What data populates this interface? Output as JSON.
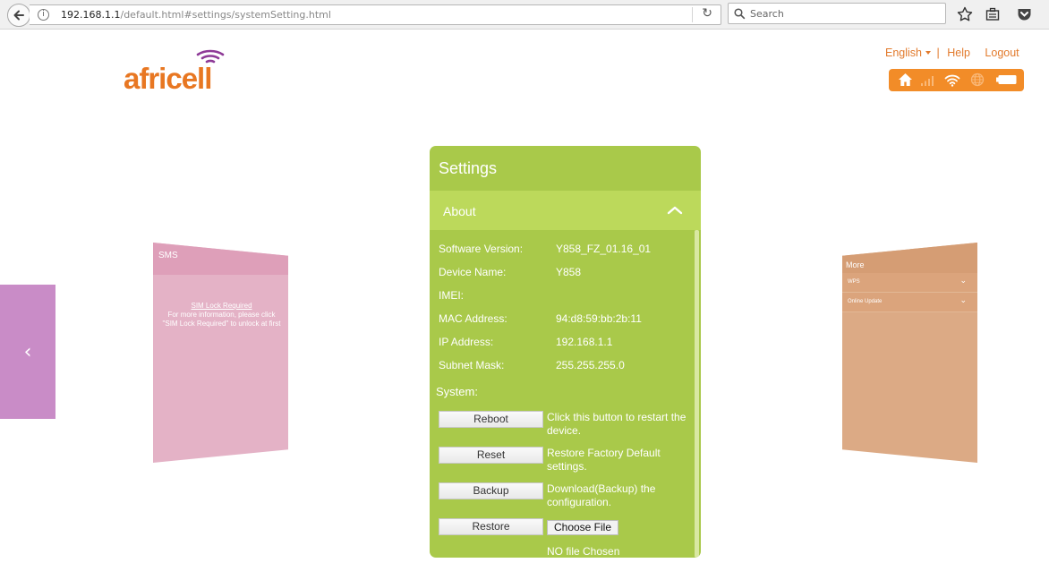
{
  "browser": {
    "url_host": "192.168.1.1",
    "url_path": "/default.html#settings/systemSetting.html",
    "search_placeholder": "Search"
  },
  "header": {
    "logo_text": "africell",
    "language": "English",
    "separator": "|",
    "help": "Help",
    "logout": "Logout"
  },
  "nav": {
    "prev_arrow": "‹"
  },
  "left_card": {
    "title": "SMS",
    "line1": "SIM Lock Required",
    "line2": "For more information, please click",
    "line3": "\"SIM Lock Required\" to unlock at first"
  },
  "right_card": {
    "title": "More",
    "items": [
      "WPS",
      "Online Update"
    ]
  },
  "settings": {
    "title": "Settings",
    "section": "About",
    "info": [
      {
        "label": "Software Version:",
        "value": "Y858_FZ_01.16_01"
      },
      {
        "label": "Device Name:",
        "value": "Y858"
      },
      {
        "label": "IMEI:",
        "value": ""
      },
      {
        "label": "MAC Address:",
        "value": "94:d8:59:bb:2b:11"
      },
      {
        "label": "IP Address:",
        "value": "192.168.1.1"
      },
      {
        "label": "Subnet Mask:",
        "value": "255.255.255.0"
      }
    ],
    "system_label": "System:",
    "actions": [
      {
        "button": "Reboot",
        "description": "Click this button to restart the device."
      },
      {
        "button": "Reset",
        "description": "Restore Factory Default settings."
      },
      {
        "button": "Backup",
        "description": "Download(Backup) the configuration."
      },
      {
        "button": "Restore",
        "description": ""
      }
    ],
    "choose_file": "Choose File",
    "no_file": "NO file Chosen"
  },
  "colors": {
    "accent_orange": "#f28c28",
    "panel_green": "#a9c94a",
    "about_green": "#bcd95b"
  }
}
